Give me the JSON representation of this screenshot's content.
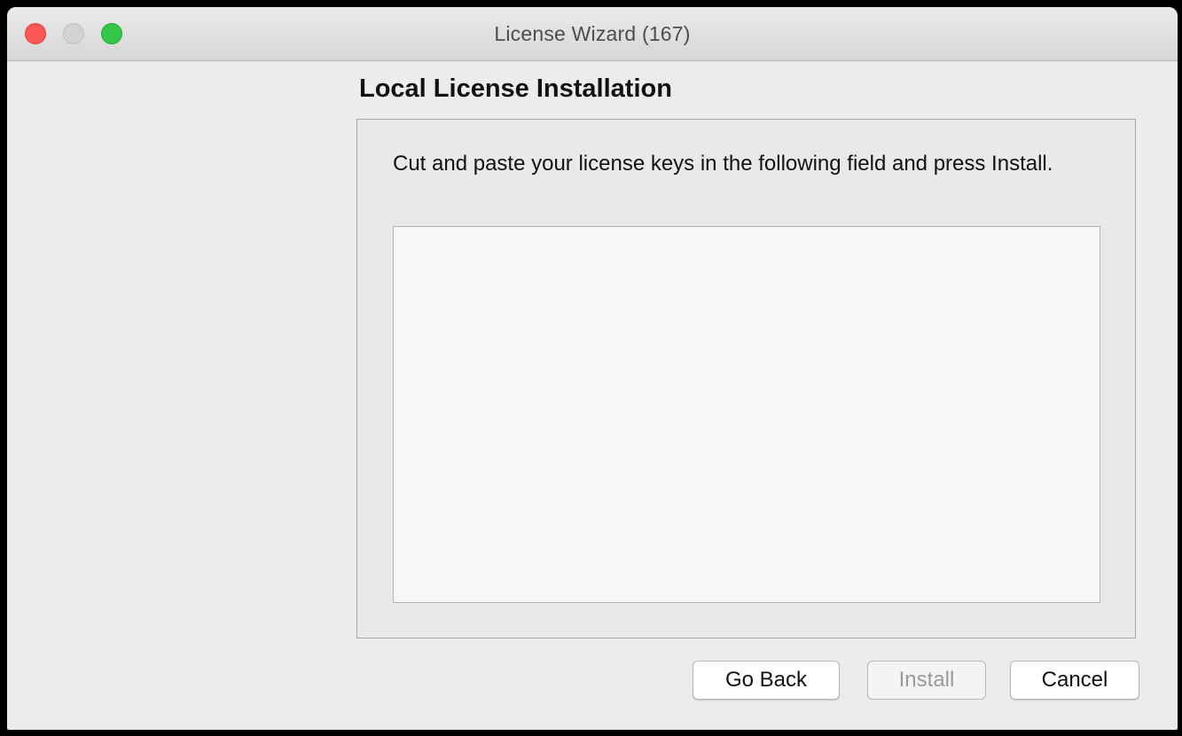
{
  "window": {
    "title": "License Wizard  (167)"
  },
  "page": {
    "heading": "Local License Installation",
    "instructions": "Cut and paste your license keys in the following field and press Install.",
    "license_keys_value": "",
    "license_keys_placeholder": ""
  },
  "buttons": {
    "go_back": "Go Back",
    "install": "Install",
    "install_enabled": false,
    "cancel": "Cancel"
  },
  "colors": {
    "close": "#fc5753",
    "minimize": "#d3d3d3",
    "zoom": "#33c748",
    "disabled_text": "#9a9a9a"
  }
}
